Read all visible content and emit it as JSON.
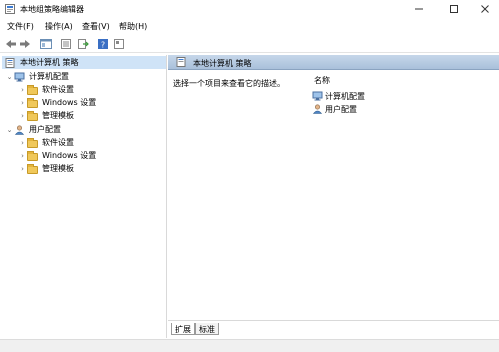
{
  "window": {
    "title": "本地组策略编辑器"
  },
  "menu": [
    "文件(F)",
    "操作(A)",
    "查看(V)",
    "帮助(H)"
  ],
  "tree": {
    "root": "本地计算机 策略",
    "computer": {
      "label": "计算机配置",
      "children": [
        "软件设置",
        "Windows 设置",
        "管理模板"
      ]
    },
    "user": {
      "label": "用户配置",
      "children": [
        "软件设置",
        "Windows 设置",
        "管理模板"
      ]
    }
  },
  "right": {
    "header": "本地计算机 策略",
    "description": "选择一个项目来查看它的描述。",
    "column": "名称",
    "items": [
      "计算机配置",
      "用户配置"
    ]
  },
  "tabs": [
    "扩展",
    "标准"
  ],
  "icons": {
    "back": "back-arrow-icon",
    "forward": "forward-arrow-icon",
    "console": "console-tree-icon",
    "properties": "properties-icon",
    "export": "export-list-icon",
    "help": "help-icon",
    "view": "view-icon"
  }
}
